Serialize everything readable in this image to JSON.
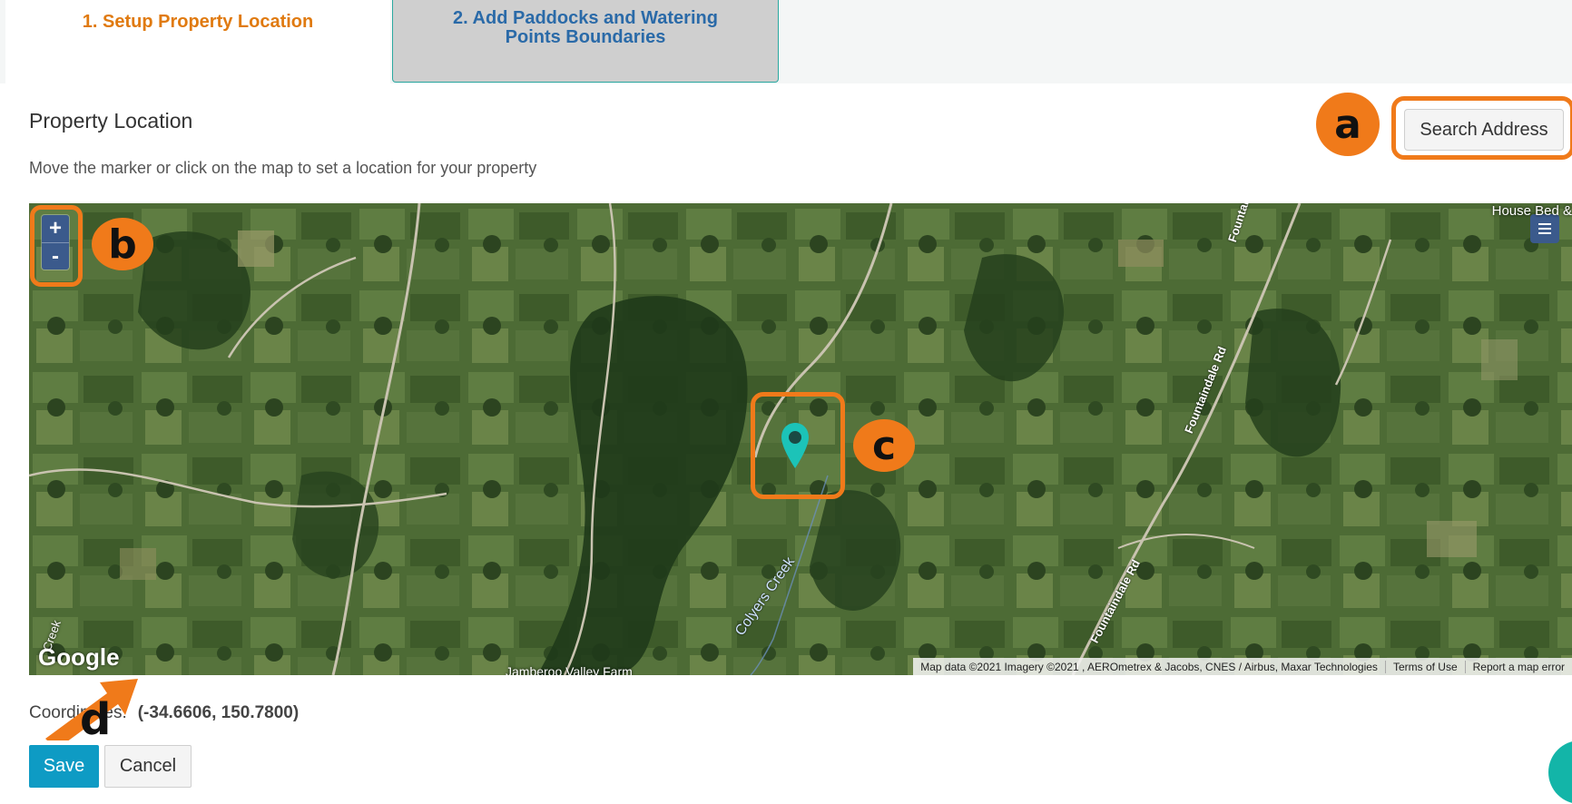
{
  "tabs": [
    {
      "label": "1. Setup Property Location",
      "active": true
    },
    {
      "label": "2. Add Paddocks and Watering Points Boundaries",
      "active": false
    }
  ],
  "header": {
    "title": "Property Location",
    "subtitle": "Move the marker or click on the map to set a location for your property",
    "search_label": "Search Address"
  },
  "map": {
    "zoom_in": "+",
    "zoom_out": "-",
    "logo": "Google",
    "labels": {
      "top_right": "House Bed &",
      "creek": "Colyers Creek",
      "road_1": "Fountaindale Rd",
      "road_2": "Fountaindale Rd",
      "road_3": "Fountaindale Rd",
      "bottom": "Jamberoo Valley Farm",
      "bottom_left": "Creek"
    },
    "attribution": "Map data ©2021 Imagery ©2021 , AEROmetrex & Jacobs, CNES / Airbus, Maxar Technologies",
    "terms": "Terms of Use",
    "report": "Report a map error",
    "marker_icon": "map-pin-icon",
    "layers_icon": "layers-icon"
  },
  "footer": {
    "coords_label": "Coordinates:",
    "coords_value": "(-34.6606, 150.7800)",
    "save": "Save",
    "cancel": "Cancel"
  },
  "annotations": {
    "a": "a",
    "b": "b",
    "c": "c",
    "d": "d"
  },
  "colors": {
    "accent_orange": "#f07a1a",
    "active_tab_text": "#e07a10",
    "inactive_tab_text": "#2a6aa8",
    "save_button": "#0e9bc4",
    "marker": "#1cc3b8",
    "map_controls": "#3b5a8c"
  }
}
